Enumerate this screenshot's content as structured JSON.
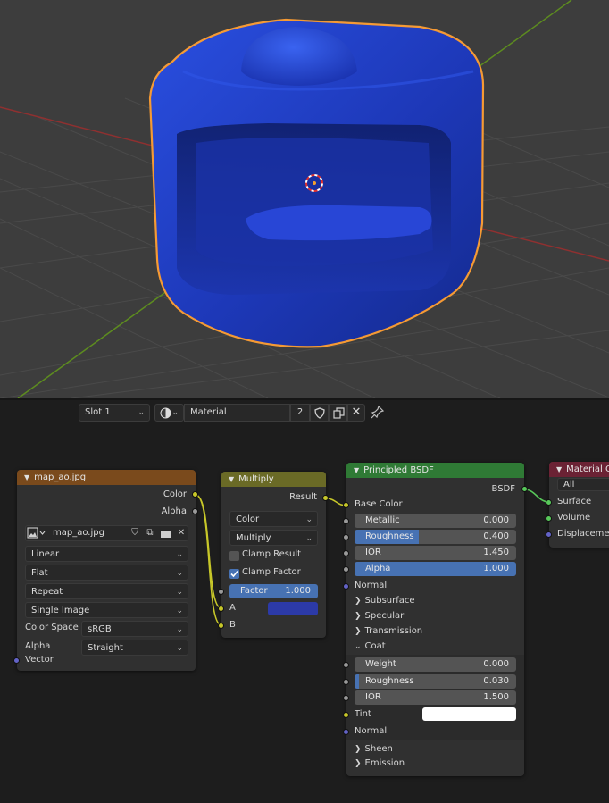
{
  "viewport": {
    "colors": {
      "background": "#3d3d3d",
      "object": "#1f3fc4",
      "outline": "#f59a34",
      "x_axis": "#8f3030",
      "y_axis": "#5d8c1f"
    },
    "origin_icon": "3d-cursor-icon"
  },
  "header": {
    "slot_label": "Slot 1",
    "material_name": "Material",
    "user_count": "2",
    "icons": [
      "material-sphere-icon",
      "fake-user-shield-icon",
      "duplicate-icon",
      "close-icon",
      "pin-icon"
    ]
  },
  "nodes": {
    "image_texture": {
      "title": "map_ao.jpg",
      "outputs": [
        "Color",
        "Alpha"
      ],
      "image_name": "map_ao.jpg",
      "interpolation": "Linear",
      "projection": "Flat",
      "extension": "Repeat",
      "source": "Single Image",
      "color_space_label": "Color Space",
      "color_space": "sRGB",
      "alpha_label": "Alpha",
      "alpha_mode": "Straight",
      "vector_label": "Vector"
    },
    "multiply": {
      "title": "Multiply",
      "output": "Result",
      "data_type": "Color",
      "blend_mode": "Multiply",
      "clamp_result": "Clamp Result",
      "clamp_result_checked": false,
      "clamp_factor": "Clamp Factor",
      "clamp_factor_checked": true,
      "factor_label": "Factor",
      "factor_value": "1.000",
      "a_label": "A",
      "b_label": "B",
      "a_color": "#2c3aa8"
    },
    "bsdf": {
      "title": "Principled BSDF",
      "output": "BSDF",
      "base_color": "Base Color",
      "metallic_label": "Metallic",
      "metallic_value": "0.000",
      "roughness_label": "Roughness",
      "roughness_value": "0.400",
      "roughness_fraction": 0.4,
      "ior_label": "IOR",
      "ior_value": "1.450",
      "alpha_label": "Alpha",
      "alpha_value": "1.000",
      "alpha_fraction": 1.0,
      "normal_label": "Normal",
      "panels": [
        "Subsurface",
        "Specular",
        "Transmission"
      ],
      "coat_label": "Coat",
      "coat_weight_label": "Weight",
      "coat_weight_value": "0.000",
      "coat_roughness_label": "Roughness",
      "coat_roughness_value": "0.030",
      "coat_roughness_fraction": 0.03,
      "coat_ior_label": "IOR",
      "coat_ior_value": "1.500",
      "coat_tint_label": "Tint",
      "coat_tint_color": "#ffffff",
      "coat_normal_label": "Normal",
      "panels_bottom": [
        "Sheen",
        "Emission"
      ]
    },
    "output": {
      "title": "Material O",
      "target": "All",
      "inputs": [
        "Surface",
        "Volume",
        "Displacement"
      ]
    }
  },
  "colors": {
    "texture_header": "#7a4a1c",
    "converter_header": "#6a6a26",
    "shader_header": "#2f7a35",
    "output_header": "#6b2234",
    "accent": "#4772b3",
    "socket_color": "#c7c729",
    "socket_float": "#9a9a9a",
    "socket_vector": "#6363c7",
    "socket_shader": "#58c85a"
  }
}
